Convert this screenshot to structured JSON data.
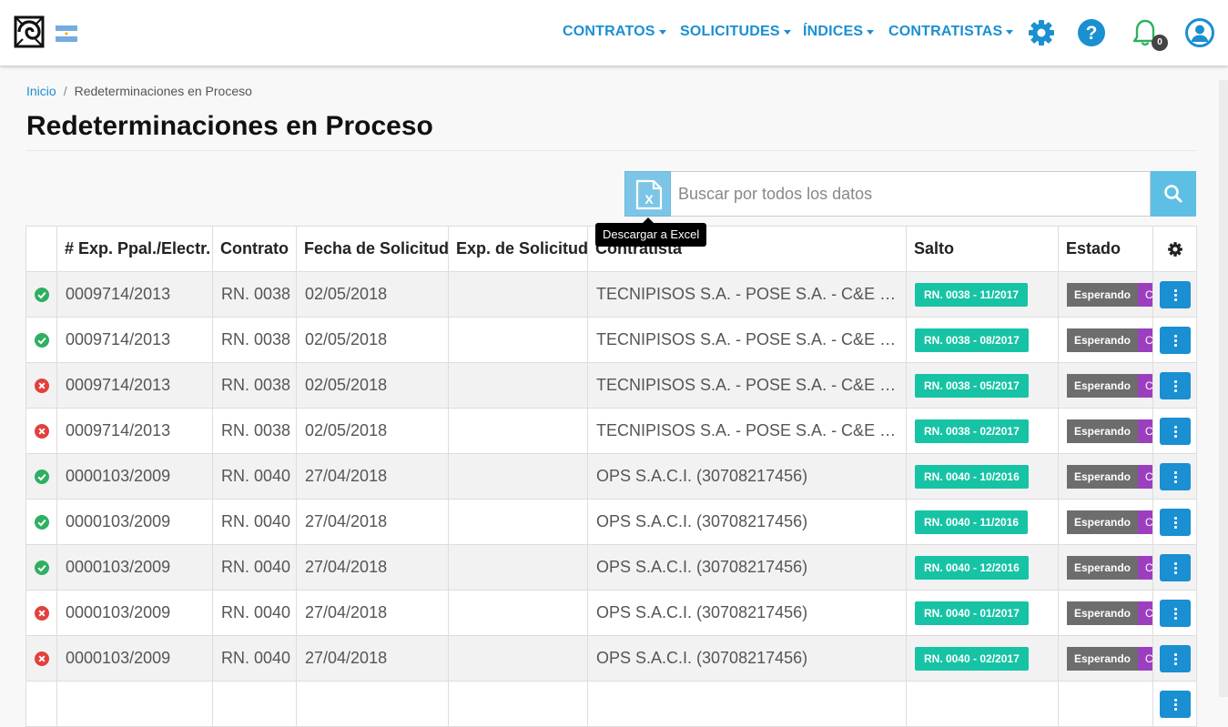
{
  "header": {
    "nav": [
      {
        "label": "CONTRATOS"
      },
      {
        "label": "SOLICITUDES"
      },
      {
        "label": "ÍNDICES"
      },
      {
        "label": "CONTRATISTAS"
      }
    ],
    "notifications_count": "0",
    "icons": [
      "settings-gear-icon",
      "help-icon",
      "bell-icon",
      "user-icon"
    ],
    "accent_color": "#1a8fd1"
  },
  "breadcrumb": {
    "home": "Inicio",
    "separator": "/",
    "current": "Redeterminaciones en Proceso"
  },
  "page_title": "Redeterminaciones en Proceso",
  "search": {
    "placeholder": "Buscar por todos los datos",
    "value": "",
    "excel_tooltip": "Descargar a Excel"
  },
  "table": {
    "headers": {
      "exp": "# Exp. Ppal./Electr.",
      "contrato": "Contrato",
      "fecha": "Fecha de Solicitud",
      "expsol": "Exp. de Solicitud",
      "contratista": "Contratista",
      "salto": "Salto",
      "estado": "Estado"
    },
    "rows": [
      {
        "status": "ok",
        "exp": "0009714/2013",
        "contrato": "RN. 0038",
        "fecha": "02/05/2018",
        "expsol": "",
        "contratista": "TECNIPISOS S.A. - POSE S.A. - C&E CONSTRUCCIONES",
        "salto": "RN. 0038 - 11/2017",
        "estado": "Esperando",
        "estado2": "C"
      },
      {
        "status": "ok",
        "exp": "0009714/2013",
        "contrato": "RN. 0038",
        "fecha": "02/05/2018",
        "expsol": "",
        "contratista": "TECNIPISOS S.A. - POSE S.A. - C&E CONSTRUCCIONES",
        "salto": "RN. 0038 - 08/2017",
        "estado": "Esperando",
        "estado2": "C"
      },
      {
        "status": "err",
        "exp": "0009714/2013",
        "contrato": "RN. 0038",
        "fecha": "02/05/2018",
        "expsol": "",
        "contratista": "TECNIPISOS S.A. - POSE S.A. - C&E CONSTRUCCIONES",
        "salto": "RN. 0038 - 05/2017",
        "estado": "Esperando",
        "estado2": "C"
      },
      {
        "status": "err",
        "exp": "0009714/2013",
        "contrato": "RN. 0038",
        "fecha": "02/05/2018",
        "expsol": "",
        "contratista": "TECNIPISOS S.A. - POSE S.A. - C&E CONSTRUCCIONES",
        "salto": "RN. 0038 - 02/2017",
        "estado": "Esperando",
        "estado2": "C"
      },
      {
        "status": "ok",
        "exp": "0000103/2009",
        "contrato": "RN. 0040",
        "fecha": "27/04/2018",
        "expsol": "",
        "contratista": "OPS S.A.C.I. (30708217456)",
        "salto": "RN. 0040 - 10/2016",
        "estado": "Esperando",
        "estado2": "C"
      },
      {
        "status": "ok",
        "exp": "0000103/2009",
        "contrato": "RN. 0040",
        "fecha": "27/04/2018",
        "expsol": "",
        "contratista": "OPS S.A.C.I. (30708217456)",
        "salto": "RN. 0040 - 11/2016",
        "estado": "Esperando",
        "estado2": "C"
      },
      {
        "status": "ok",
        "exp": "0000103/2009",
        "contrato": "RN. 0040",
        "fecha": "27/04/2018",
        "expsol": "",
        "contratista": "OPS S.A.C.I. (30708217456)",
        "salto": "RN. 0040 - 12/2016",
        "estado": "Esperando",
        "estado2": "C"
      },
      {
        "status": "err",
        "exp": "0000103/2009",
        "contrato": "RN. 0040",
        "fecha": "27/04/2018",
        "expsol": "",
        "contratista": "OPS S.A.C.I. (30708217456)",
        "salto": "RN. 0040 - 01/2017",
        "estado": "Esperando",
        "estado2": "C"
      },
      {
        "status": "err",
        "exp": "0000103/2009",
        "contrato": "RN. 0040",
        "fecha": "27/04/2018",
        "expsol": "",
        "contratista": "OPS S.A.C.I. (30708217456)",
        "salto": "RN. 0040 - 02/2017",
        "estado": "Esperando",
        "estado2": "C"
      },
      {
        "status": "",
        "exp": "",
        "contrato": "",
        "fecha": "",
        "expsol": "",
        "contratista": "",
        "salto": "",
        "estado": "",
        "estado2": "",
        "partial": true
      }
    ],
    "status_colors": {
      "ok": "#2eb060",
      "err": "#e2413d"
    },
    "salto_color": "#17c3a5",
    "estado_color": "#6d6d6d",
    "estado2_color": "#9c3fbf"
  }
}
